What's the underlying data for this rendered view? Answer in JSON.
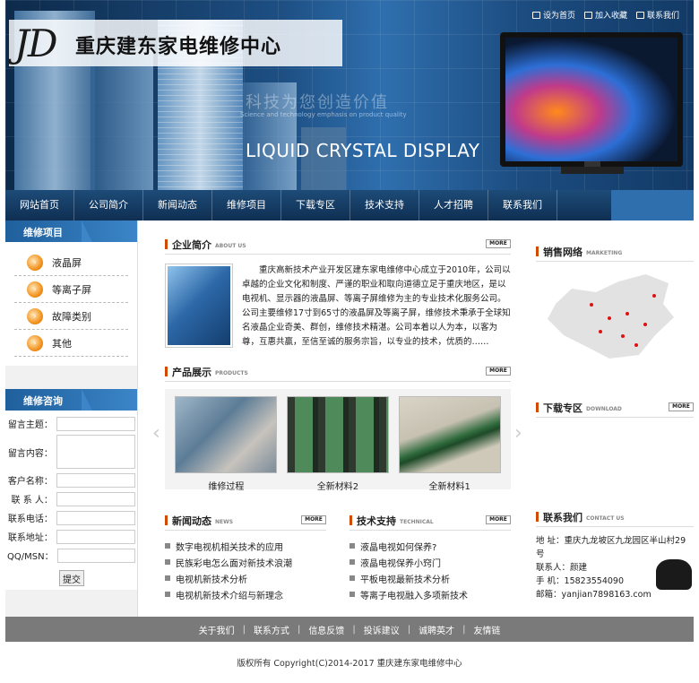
{
  "header": {
    "logo_mark": "JD",
    "site_name": "重庆建东家电维修中心",
    "slogan": "科技为您创造价值",
    "slogan_en": "Science and technology emphasis on product quality",
    "banner_text": "LIQUID CRYSTAL DISPLAY",
    "top_links": [
      "设为首页",
      "加入收藏",
      "联系我们"
    ]
  },
  "nav": [
    "网站首页",
    "公司简介",
    "新闻动态",
    "维修项目",
    "下载专区",
    "技术支持",
    "人才招聘",
    "联系我们"
  ],
  "sidebar": {
    "repair_title": "维修项目",
    "repair_items": [
      "液晶屏",
      "等离子屏",
      "故障类别",
      "其他"
    ],
    "consult_title": "维修咨询",
    "form_labels": [
      "留言主题：",
      "留言内容：",
      "客户名称：",
      "联 系 人：",
      "联系电话：",
      "联系地址：",
      "QQ/MSN："
    ],
    "submit": "提交"
  },
  "about": {
    "title": "企业简介",
    "title_en": "ABOUT US",
    "more": "MORE",
    "text": "重庆高新技术产业开发区建东家电维修中心成立于2010年，公司以卓越的企业文化和制度、严谨的职业和取向道德立足于重庆地区，是以电视机、显示器的液晶屏、等离子屏维修为主的专业技术化服务公司。公司主要维修17寸到65寸的液晶屏及等离子屏，维修技术秉承于全球知名液晶企业奇美、群创，维修技术精湛。公司本着以人为本，以客为尊，互惠共赢，至信至诚的服务宗旨，以专业的技术，优质的……"
  },
  "products": {
    "title": "产品展示",
    "title_en": "PRODUCTS",
    "more": "MORE",
    "items": [
      "维修过程",
      "全新材料2",
      "全新材料1"
    ]
  },
  "news": {
    "title": "新闻动态",
    "title_en": "NEWS",
    "more": "MORE",
    "items": [
      "数字电视机相关技术的应用",
      "民族彩电怎么面对新技术浪潮",
      "电视机新技术分析",
      "电视机新技术介绍与新理念"
    ]
  },
  "tech": {
    "title": "技术支持",
    "title_en": "TECHNICAL",
    "more": "MORE",
    "items": [
      "液晶电视如何保养?",
      "液晶电视保养小窍门",
      "平板电视最新技术分析",
      "等离子电视融入多项新技术"
    ]
  },
  "sales": {
    "title": "销售网络",
    "title_en": "MARKETING"
  },
  "download": {
    "title": "下载专区",
    "title_en": "DOWNLOAD",
    "more": "MORE"
  },
  "contact": {
    "title": "联系我们",
    "title_en": "CONTACT US",
    "address": "地 址：重庆九龙坡区九龙园区半山村29号",
    "person": "联系人：颜建",
    "mobile": "手 机：15823554090",
    "email": "邮箱：yanjian7898163.com"
  },
  "footer": {
    "links": [
      "关于我们",
      "联系方式",
      "信息反馈",
      "投诉建议",
      "诚聘英才",
      "友情链"
    ],
    "copyright": "版权所有 Copyright(C)2014-2017 重庆建东家电维修中心"
  }
}
